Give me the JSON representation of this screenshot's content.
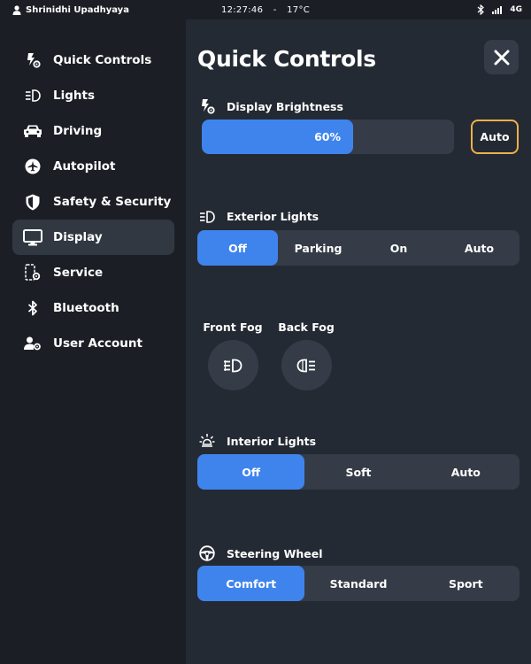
{
  "status": {
    "user_name": "Shrinidhi Upadhyaya",
    "time": "12:27:46",
    "separator": "-",
    "temperature": "17°C",
    "network": "4G"
  },
  "sidebar": {
    "items": [
      {
        "label": "Quick Controls",
        "icon": "bolt-gear-icon"
      },
      {
        "label": "Lights",
        "icon": "headlight-icon"
      },
      {
        "label": "Driving",
        "icon": "car-icon"
      },
      {
        "label": "Autopilot",
        "icon": "plane-icon"
      },
      {
        "label": "Safety & Security",
        "icon": "shield-icon"
      },
      {
        "label": "Display",
        "icon": "monitor-icon",
        "active": true
      },
      {
        "label": "Service",
        "icon": "phone-gear-icon"
      },
      {
        "label": "Bluetooth",
        "icon": "bluetooth-icon"
      },
      {
        "label": "User Account",
        "icon": "user-gear-icon"
      }
    ]
  },
  "panel": {
    "title": "Quick Controls",
    "brightness": {
      "label": "Display Brightness",
      "value_text": "60%",
      "value": 0.6,
      "auto_label": "Auto"
    },
    "exterior_lights": {
      "label": "Exterior Lights",
      "options": [
        "Off",
        "Parking",
        "On",
        "Auto"
      ],
      "selected": "Off"
    },
    "fog": {
      "front_label": "Front Fog",
      "back_label": "Back Fog"
    },
    "interior_lights": {
      "label": "Interior Lights",
      "options": [
        "Off",
        "Soft",
        "Auto"
      ],
      "selected": "Off"
    },
    "steering": {
      "label": "Steering Wheel",
      "options": [
        "Comfort",
        "Standard",
        "Sport"
      ],
      "selected": "Comfort"
    }
  },
  "colors": {
    "accent": "#3f84ec",
    "auto_border": "#f0b04b",
    "panel_bg": "#242a33",
    "control_bg": "#353c47"
  }
}
